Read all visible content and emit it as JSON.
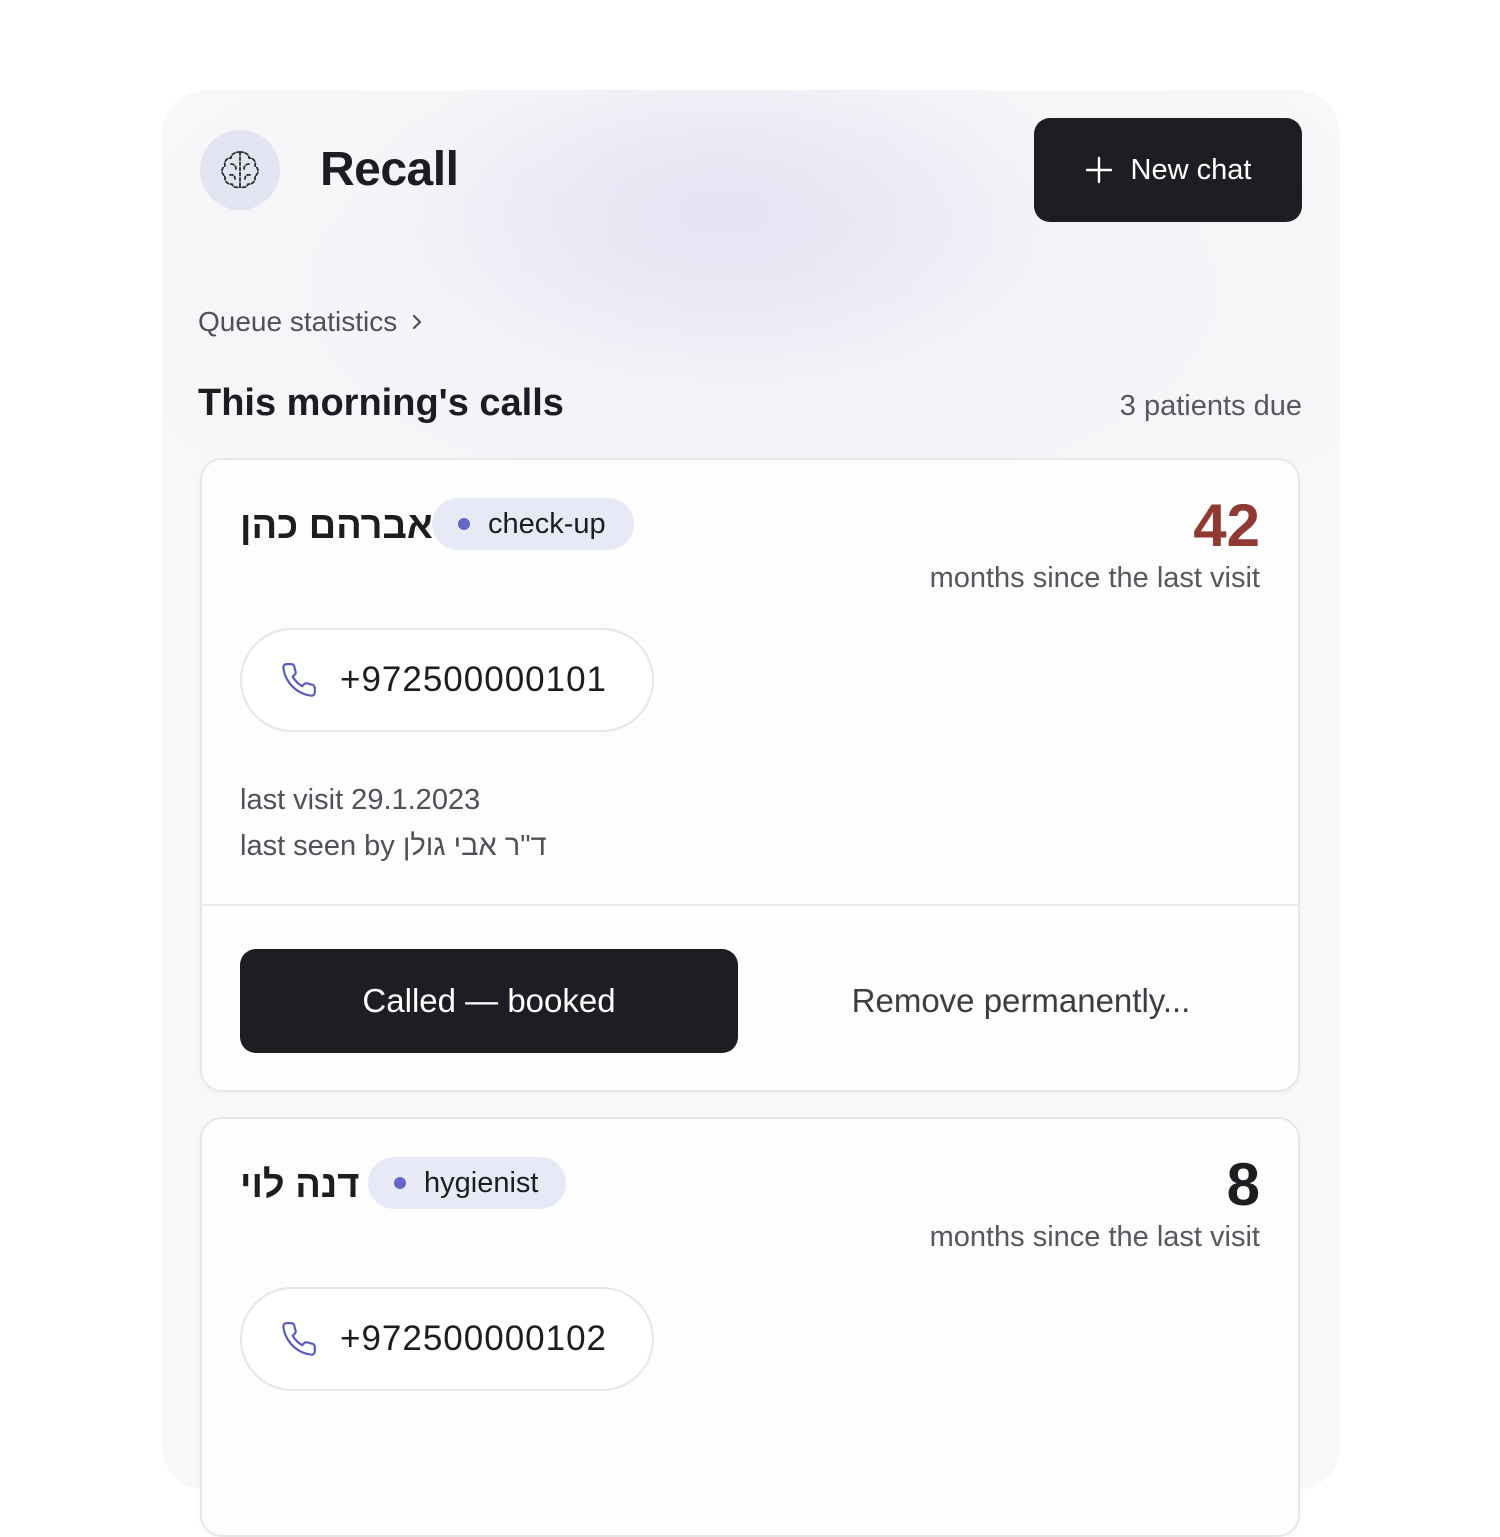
{
  "header": {
    "app_title": "Recall",
    "new_chat_label": "New chat"
  },
  "breadcrumb": {
    "label": "Queue statistics"
  },
  "section": {
    "title": "This morning's calls",
    "due_count": "3 patients due"
  },
  "colors": {
    "overdue_accent": "#8e3a32",
    "tag_dot": "#6567c8",
    "button_dark": "#1d1e22"
  },
  "patients": [
    {
      "name": "אברהם כהן",
      "tag": "check-up",
      "months": "42",
      "months_label": "months since the last visit",
      "phone": "+972500000101",
      "last_visit": "last visit 29.1.2023",
      "last_seen": "last seen by ד\"ר אבי גולן",
      "primary_action": "Called — booked",
      "secondary_action": "Remove permanently..."
    },
    {
      "name": "דנה לוי",
      "tag": "hygienist",
      "months": "8",
      "months_label": "months since the last visit",
      "phone": "+972500000102"
    }
  ]
}
